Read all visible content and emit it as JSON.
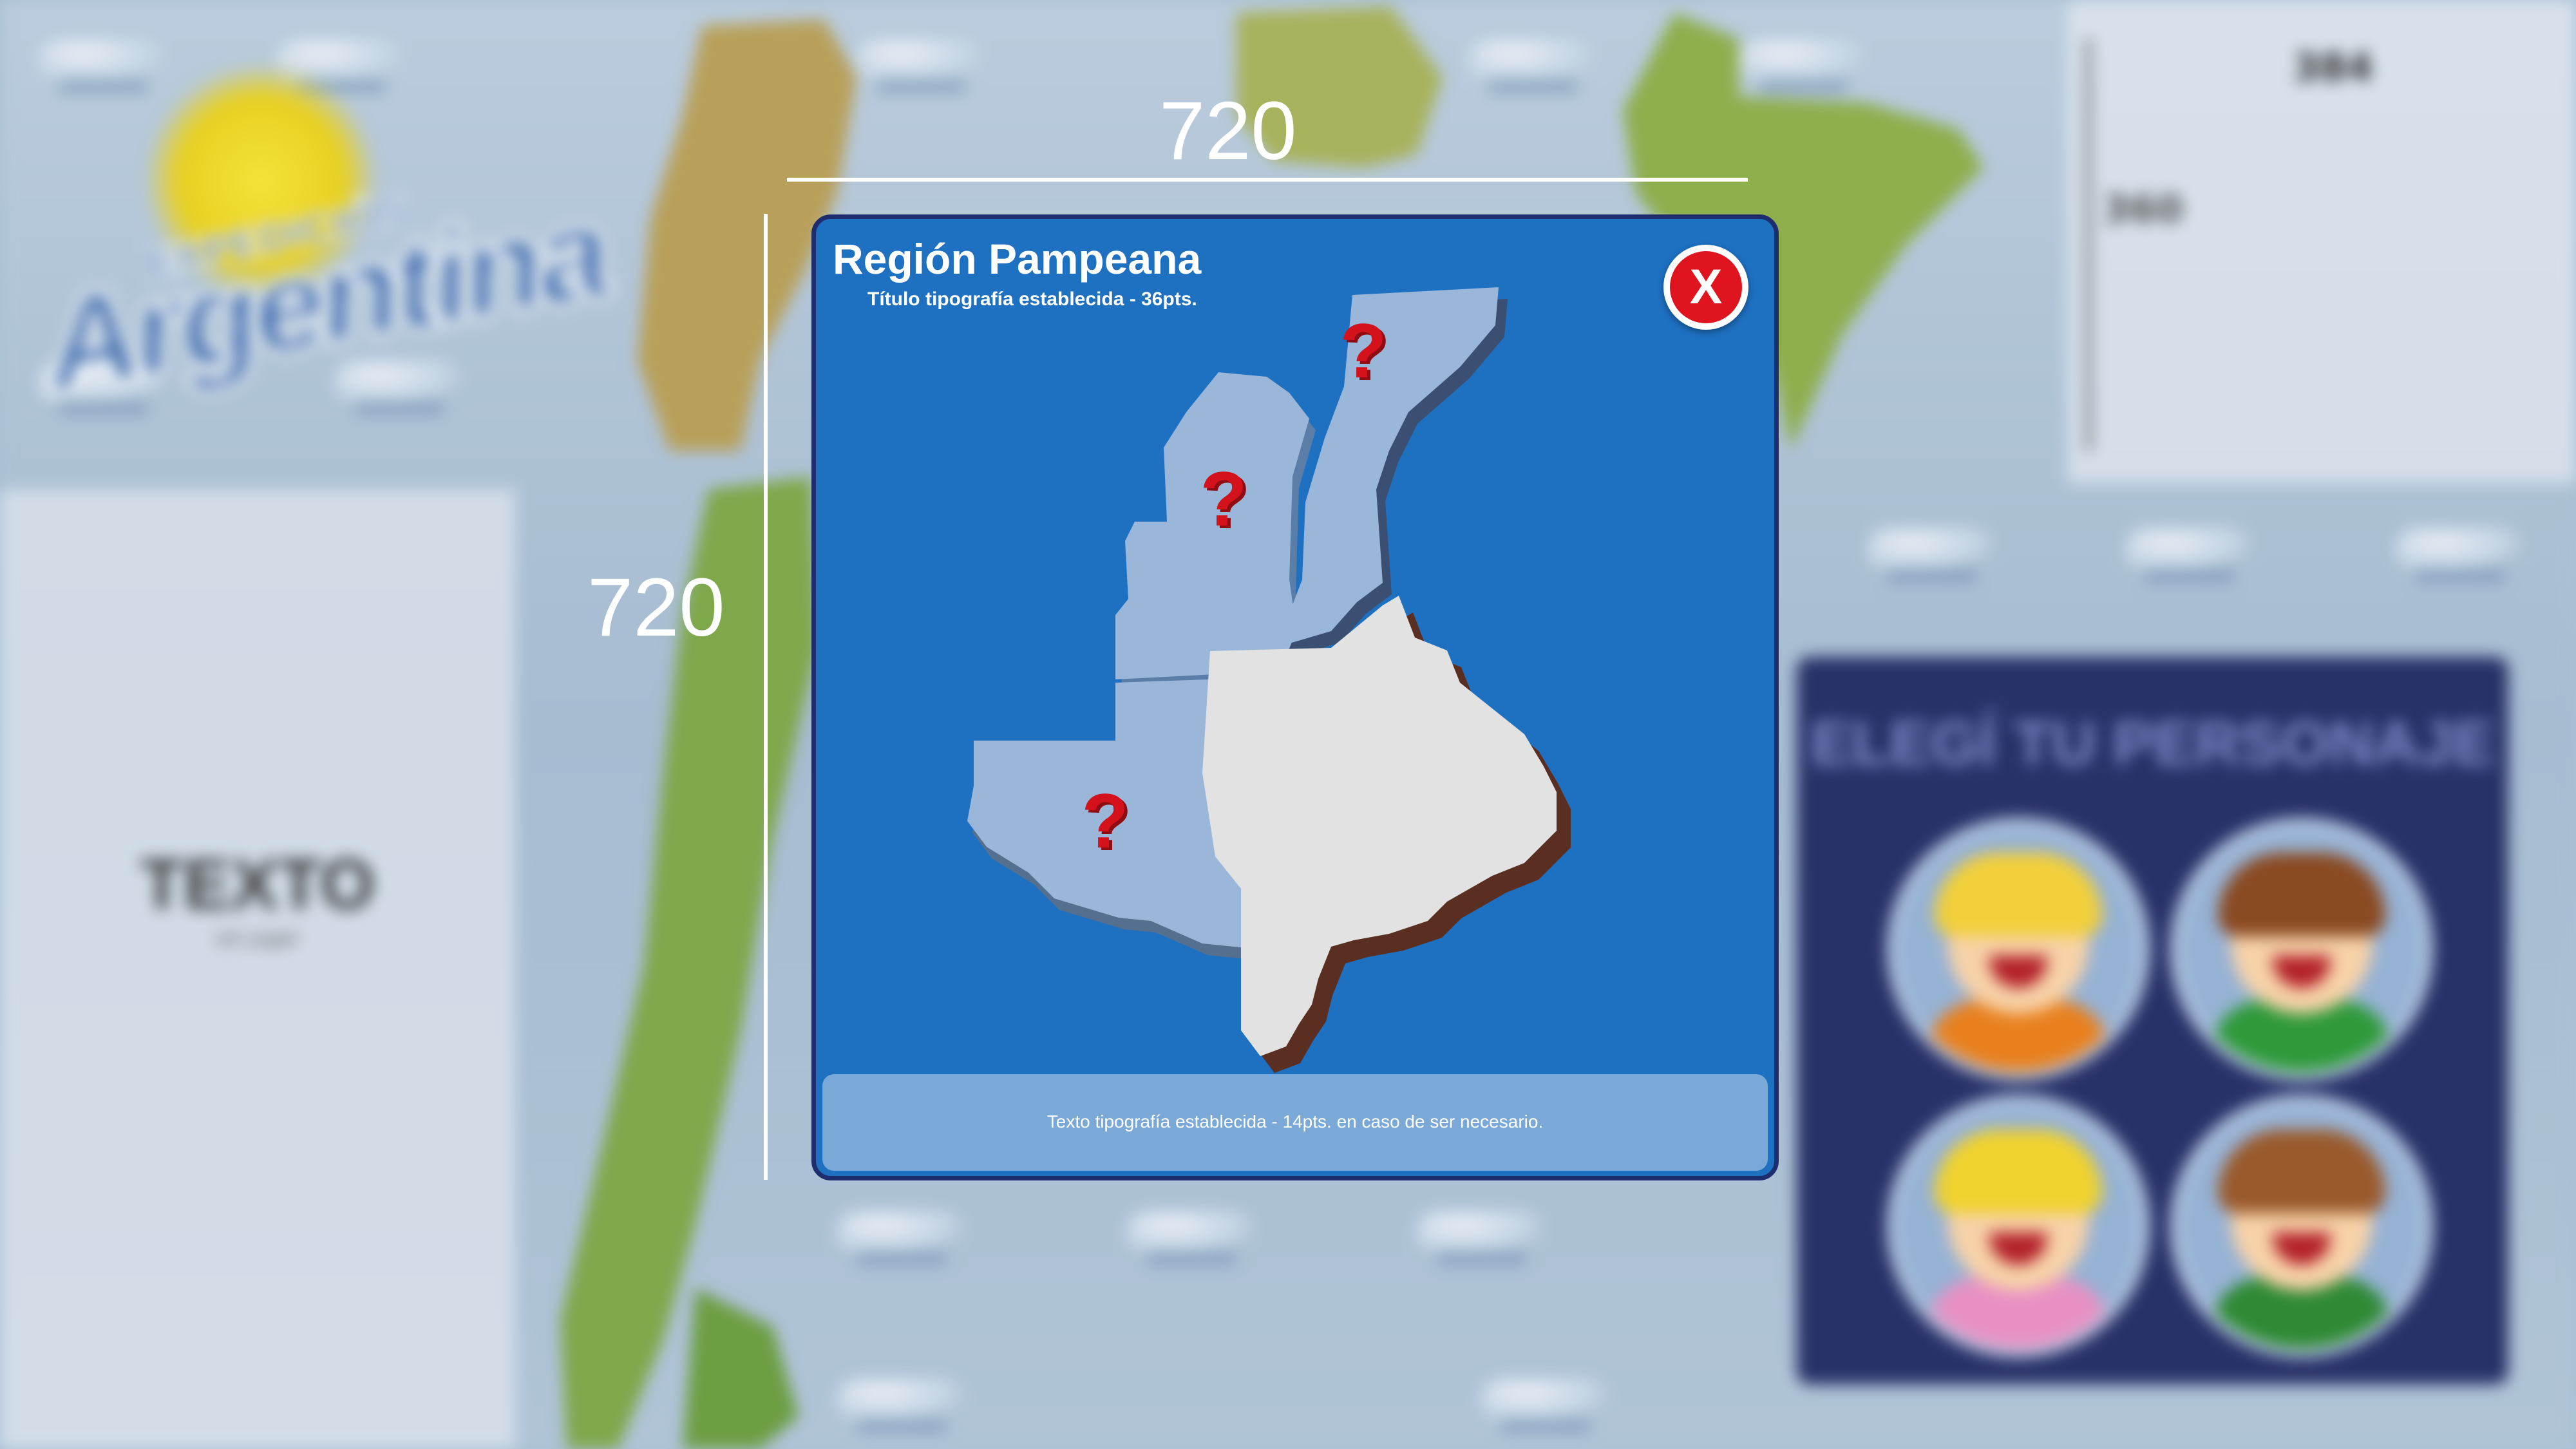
{
  "background": {
    "logo": {
      "subtitle": "EXPEDICIÓN",
      "title": "Argentina"
    },
    "left_panel": {
      "title": "TEXTO",
      "subtitle": "sin jugar"
    },
    "top_right_panel": {
      "number_top": "384",
      "number_side": "360"
    },
    "character_panel": {
      "title": "ELEGÍ TU PERSONAJE",
      "avatars": [
        "avatar-boy-blond",
        "avatar-boy-brown",
        "avatar-girl-blonde",
        "avatar-girl-brown"
      ]
    }
  },
  "annotations": {
    "width_label": "720",
    "height_label": "720"
  },
  "modal": {
    "title": "Región Pampeana",
    "subtitle": "Título tipografía establecida - 36pts.",
    "close_label": "X",
    "footer_text": "Texto tipografía establecida - 14pts. en caso de ser necesario.",
    "map_marker": "?",
    "colors": {
      "background": "#1e70c1",
      "border": "#1e2d6e",
      "province_locked": "#9ab7d9",
      "province_selected": "#e2e2e2",
      "province_shadow": "#5a2e20",
      "marker": "#d3121c",
      "close_button": "#e0141e",
      "footer": "#7aa9d8"
    }
  },
  "icons": [
    "close-icon",
    "question-mark-icon"
  ]
}
